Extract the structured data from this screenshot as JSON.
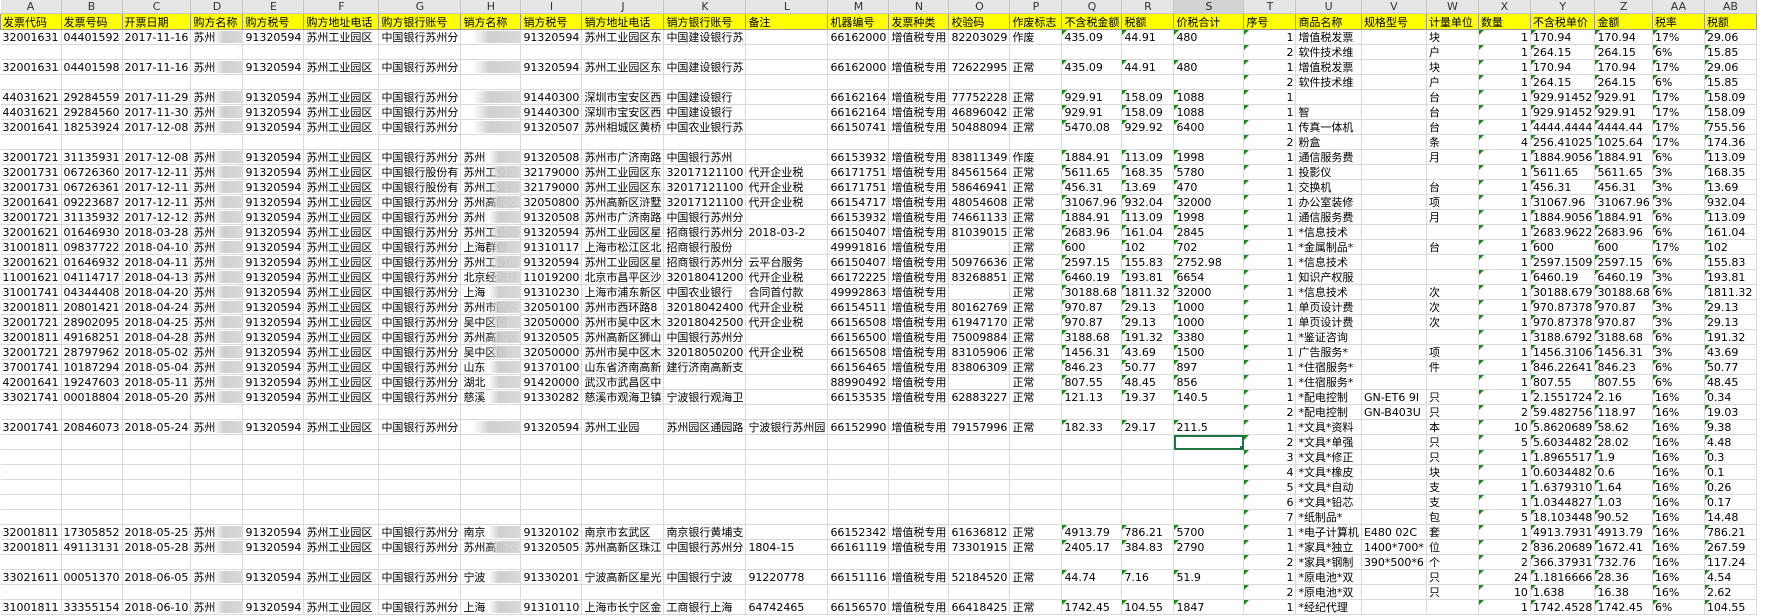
{
  "columns": [
    {
      "letter": "A",
      "header": "发票代码"
    },
    {
      "letter": "B",
      "header": "发票号码"
    },
    {
      "letter": "C",
      "header": "开票日期"
    },
    {
      "letter": "D",
      "header": "购方名称"
    },
    {
      "letter": "E",
      "header": "购方税号"
    },
    {
      "letter": "F",
      "header": "购方地址电话"
    },
    {
      "letter": "G",
      "header": "购方银行账号"
    },
    {
      "letter": "H",
      "header": "销方名称"
    },
    {
      "letter": "I",
      "header": "销方税号"
    },
    {
      "letter": "J",
      "header": "销方地址电话"
    },
    {
      "letter": "K",
      "header": "销方银行账号"
    },
    {
      "letter": "L",
      "header": "备注"
    },
    {
      "letter": "M",
      "header": "机器编号"
    },
    {
      "letter": "N",
      "header": "发票种类"
    },
    {
      "letter": "O",
      "header": "校验码"
    },
    {
      "letter": "P",
      "header": "作废标志"
    },
    {
      "letter": "Q",
      "header": "不含税金额"
    },
    {
      "letter": "R",
      "header": "税额"
    },
    {
      "letter": "S",
      "header": "价税合计"
    },
    {
      "letter": "T",
      "header": "序号"
    },
    {
      "letter": "U",
      "header": "商品名称"
    },
    {
      "letter": "V",
      "header": "规格型号"
    },
    {
      "letter": "W",
      "header": "计量单位"
    },
    {
      "letter": "X",
      "header": "数量"
    },
    {
      "letter": "Y",
      "header": "不含税单价"
    },
    {
      "letter": "Z",
      "header": "金额"
    },
    {
      "letter": "AA",
      "header": "税率"
    },
    {
      "letter": "AB",
      "header": "税额"
    }
  ],
  "selected_column": "S",
  "active_cell": {
    "row": 27,
    "col": "S"
  },
  "rows": [
    [
      "32001631",
      "04401592",
      "2017-11-16",
      "苏州",
      "91320594",
      "苏州工业园区",
      "中国银行苏州分",
      "",
      "91320594",
      "苏州工业园区东",
      "中国建设银行苏",
      "",
      "66162000",
      "增值税专用",
      "82203029",
      "作废",
      "435.09",
      "44.91",
      "480",
      "1",
      "增值税发票",
      "",
      "块",
      "1",
      "170.94",
      "170.94",
      "17%",
      "29.06"
    ],
    [
      "",
      "",
      "",
      "",
      "",
      "",
      "",
      "",
      "",
      "",
      "",
      "",
      "",
      "",
      "",
      "",
      "",
      "",
      "",
      "2",
      "软件技术维",
      "",
      "户",
      "1",
      "264.15",
      "264.15",
      "6%",
      "15.85"
    ],
    [
      "32001631",
      "04401598",
      "2017-11-16",
      "苏州",
      "91320594",
      "苏州工业园区",
      "中国银行苏州分",
      "",
      "91320594",
      "苏州工业园区东",
      "中国建设银行苏",
      "",
      "66162000",
      "增值税专用",
      "72622995",
      "正常",
      "435.09",
      "44.91",
      "480",
      "1",
      "增值税发票",
      "",
      "块",
      "1",
      "170.94",
      "170.94",
      "17%",
      "29.06"
    ],
    [
      "",
      "",
      "",
      "",
      "",
      "",
      "",
      "",
      "",
      "",
      "",
      "",
      "",
      "",
      "",
      "",
      "",
      "",
      "",
      "2",
      "软件技术维",
      "",
      "户",
      "1",
      "264.15",
      "264.15",
      "6%",
      "15.85"
    ],
    [
      "44031621",
      "29284559",
      "2017-11-29",
      "苏州",
      "91320594",
      "苏州工业园区",
      "中国银行苏州分",
      "",
      "91440300",
      "深圳市宝安区西",
      "中国建设银行",
      "",
      "66162164",
      "增值税专用",
      "77752228",
      "正常",
      "929.91",
      "158.09",
      "1088",
      "1",
      "",
      "",
      "台",
      "1",
      "929.91452",
      "929.91",
      "17%",
      "158.09"
    ],
    [
      "44031621",
      "29284560",
      "2017-11-30",
      "苏州",
      "91320594",
      "苏州工业园区",
      "中国银行苏州分",
      "",
      "91440300",
      "深圳市宝安区西",
      "中国建设银行",
      "",
      "66162164",
      "增值税专用",
      "46896042",
      "正常",
      "929.91",
      "158.09",
      "1088",
      "1",
      "智",
      "",
      "台",
      "1",
      "929.91452",
      "929.91",
      "17%",
      "158.09"
    ],
    [
      "32001641",
      "18253924",
      "2017-12-08",
      "苏州",
      "91320594",
      "苏州工业园区",
      "中国银行苏州分",
      "",
      "91320507",
      "苏州相城区黄桥",
      "中国农业银行苏",
      "",
      "66150741",
      "增值税专用",
      "50488094",
      "正常",
      "5470.08",
      "929.92",
      "6400",
      "1",
      "传真一体机",
      "",
      "台",
      "1",
      "4444.4444",
      "4444.44",
      "17%",
      "755.56"
    ],
    [
      "",
      "",
      "",
      "",
      "",
      "",
      "",
      "",
      "",
      "",
      "",
      "",
      "",
      "",
      "",
      "",
      "",
      "",
      "",
      "2",
      "粉盒",
      "",
      "条",
      "4",
      "256.41025",
      "1025.64",
      "17%",
      "174.36"
    ],
    [
      "32001721",
      "31135931",
      "2017-12-08",
      "苏州",
      "91320594",
      "苏州工业园区",
      "中国银行苏州分",
      "苏州",
      "91320508",
      "苏州市广济南路",
      "中国银行苏州",
      "",
      "66153932",
      "增值税专用",
      "83811349",
      "作废",
      "1884.91",
      "113.09",
      "1998",
      "1",
      "通信服务费",
      "",
      "月",
      "1",
      "1884.9056",
      "1884.91",
      "6%",
      "113.09"
    ],
    [
      "32001731",
      "06726360",
      "2017-12-11",
      "苏州",
      "91320594",
      "苏州工业园区",
      "中国银行股份有",
      "苏州工业园",
      "32179000",
      "苏州工业园区东",
      "32017121100",
      "代开企业税",
      "66171751",
      "增值税专用",
      "84561564",
      "正常",
      "5611.65",
      "168.35",
      "5780",
      "1",
      "投影仪",
      "",
      "",
      "1",
      "5611.65",
      "5611.65",
      "3%",
      "168.35"
    ],
    [
      "32001731",
      "06726361",
      "2017-12-11",
      "苏州",
      "91320594",
      "苏州工业园区",
      "中国银行股份有",
      "苏州工业园",
      "32179000",
      "苏州工业园区东",
      "32017121100",
      "代开企业税",
      "66171751",
      "增值税专用",
      "58646941",
      "正常",
      "456.31",
      "13.69",
      "470",
      "1",
      "交换机",
      "",
      "台",
      "1",
      "456.31",
      "456.31",
      "3%",
      "13.69"
    ],
    [
      "32001641",
      "09223687",
      "2017-12-11",
      "苏州",
      "91320594",
      "苏州工业园区",
      "中国银行苏州分",
      "苏州高新区",
      "32050800",
      "苏州高新区浒墅",
      "32017121100",
      "代开企业税",
      "66154717",
      "增值税专用",
      "48054608",
      "正常",
      "31067.96",
      "932.04",
      "32000",
      "1",
      "办公室装修",
      "",
      "项",
      "1",
      "31067.96",
      "31067.96",
      "3%",
      "932.04"
    ],
    [
      "32001721",
      "31135932",
      "2017-12-12",
      "苏州",
      "91320594",
      "苏州工业园区",
      "中国银行苏州分",
      "苏州",
      "91320508",
      "苏州市广济南路",
      "中国银行苏州分",
      "",
      "66153932",
      "增值税专用",
      "74661133",
      "正常",
      "1884.91",
      "113.09",
      "1998",
      "1",
      "通信服务费",
      "",
      "月",
      "1",
      "1884.9056",
      "1884.91",
      "6%",
      "113.09"
    ],
    [
      "32001621",
      "01646930",
      "2018-03-28",
      "苏州",
      "91320594",
      "苏州工业园区",
      "中国银行苏州分",
      "苏州工业园",
      "91320594",
      "苏州工业园区星",
      "招商银行苏州分",
      "2018-03-2",
      "66150407",
      "增值税专用",
      "81039015",
      "正常",
      "2683.96",
      "161.04",
      "2845",
      "1",
      "*信息技术",
      "",
      "",
      "1",
      "2683.9622",
      "2683.96",
      "6%",
      "161.04"
    ],
    [
      "31001811",
      "09837722",
      "2018-04-10",
      "苏州",
      "91320594",
      "苏州工业园区",
      "中国银行苏州分",
      "上海群傲",
      "91310117",
      "上海市松江区北",
      "招商银行股份",
      "",
      "49991816",
      "增值税专用",
      "",
      "正常",
      "600",
      "102",
      "702",
      "1",
      "*金属制品*",
      "",
      "台",
      "1",
      "600",
      "600",
      "17%",
      "102"
    ],
    [
      "32001621",
      "01646932",
      "2018-04-11",
      "苏州",
      "91320594",
      "苏州工业园区",
      "中国银行苏州分",
      "苏州工业园",
      "91320594",
      "苏州工业园区星",
      "招商银行苏州分",
      "云平台服务",
      "66150407",
      "增值税专用",
      "50976636",
      "正常",
      "2597.15",
      "155.83",
      "2752.98",
      "1",
      "*信息技术",
      "",
      "",
      "1",
      "2597.1509",
      "2597.15",
      "6%",
      "155.83"
    ],
    [
      "11001621",
      "04114717",
      "2018-04-13",
      "苏州",
      "91320594",
      "苏州工业园区",
      "中国银行苏州分",
      "北京经济技",
      "11019200",
      "北京市昌平区沙",
      "32018041200",
      "代开企业税",
      "66172225",
      "增值税专用",
      "83268851",
      "正常",
      "6460.19",
      "193.81",
      "6654",
      "1",
      "知识产权服",
      "",
      "",
      "1",
      "6460.19",
      "6460.19",
      "3%",
      "193.81"
    ],
    [
      "31001741",
      "04344408",
      "2018-04-20",
      "苏州",
      "91320594",
      "苏州工业园区",
      "中国银行苏州分",
      "上海",
      "91310230",
      "上海市浦东新区",
      "中国农业银行",
      "合同首付款",
      "49992863",
      "增值税专用",
      "",
      "正常",
      "30188.68",
      "1811.32",
      "32000",
      "1",
      "*信息技术",
      "",
      "次",
      "1",
      "30188.679",
      "30188.68",
      "6%",
      "1811.32"
    ],
    [
      "32001811",
      "20801421",
      "2018-04-24",
      "苏州",
      "91320594",
      "苏州工业园区",
      "中国银行苏州分",
      "苏州市园区",
      "32050100",
      "苏州市西环路8",
      "32018042400",
      "代开企业税",
      "66154511",
      "增值税专用",
      "80162769",
      "正常",
      "970.87",
      "29.13",
      "1000",
      "1",
      "单页设计费",
      "",
      "次",
      "1",
      "970.87378",
      "970.87",
      "3%",
      "29.13"
    ],
    [
      "32001721",
      "28902095",
      "2018-04-25",
      "苏州",
      "91320594",
      "苏州工业园区",
      "中国银行苏州分",
      "吴中区国",
      "32050000",
      "苏州市吴中区木",
      "32018042500",
      "代开企业税",
      "66156508",
      "增值税专用",
      "61947170",
      "正常",
      "970.87",
      "29.13",
      "1000",
      "1",
      "单页设计费",
      "",
      "次",
      "1",
      "970.87378",
      "970.87",
      "3%",
      "29.13"
    ],
    [
      "32001811",
      "49168251",
      "2018-04-28",
      "苏州",
      "91320594",
      "苏州工业园区",
      "中国银行苏州分",
      "苏州高新区",
      "91320505",
      "苏州高新区狮山",
      "中国银行苏州分",
      "",
      "66156500",
      "增值税专用",
      "75009884",
      "正常",
      "3188.68",
      "191.32",
      "3380",
      "1",
      "*鉴证咨询",
      "",
      "",
      "1",
      "3188.6792",
      "3188.68",
      "6%",
      "191.32"
    ],
    [
      "32001721",
      "28797962",
      "2018-05-02",
      "苏州",
      "91320594",
      "苏州工业园区",
      "中国银行苏州分",
      "吴中区国",
      "32050000",
      "苏州市吴中区木",
      "32018050200",
      "代开企业税",
      "66156508",
      "增值税专用",
      "83105906",
      "正常",
      "1456.31",
      "43.69",
      "1500",
      "1",
      "广告服务*",
      "",
      "项",
      "1",
      "1456.3106",
      "1456.31",
      "3%",
      "43.69"
    ],
    [
      "37001741",
      "10187294",
      "2018-05-04",
      "苏州",
      "91320594",
      "苏州工业园区",
      "中国银行苏州分",
      "山东",
      "91370100",
      "山东省济南高新",
      "建行济南高新支",
      "",
      "66156465",
      "增值税专用",
      "83806309",
      "正常",
      "846.23",
      "50.77",
      "897",
      "1",
      "*住宿服务*",
      "",
      "件",
      "1",
      "846.22641",
      "846.23",
      "6%",
      "50.77"
    ],
    [
      "42001641",
      "19247603",
      "2018-05-11",
      "苏州",
      "91320594",
      "苏州工业园区",
      "中国银行苏州分",
      "湖北",
      "91420000",
      "武汉市武昌区中",
      "",
      "",
      "88990492",
      "增值税专用",
      "",
      "正常",
      "807.55",
      "48.45",
      "856",
      "1",
      "*住宿服务*",
      "",
      "",
      "1",
      "807.55",
      "807.55",
      "6%",
      "48.45"
    ],
    [
      "33021741",
      "00018804",
      "2018-05-20",
      "苏州",
      "91320594",
      "苏州工业园区",
      "中国银行苏州分",
      "慈溪",
      "91330282",
      "慈溪市观海卫镇",
      "宁波银行观海卫",
      "",
      "66153535",
      "增值税专用",
      "62883227",
      "正常",
      "121.13",
      "19.37",
      "140.5",
      "1",
      "*配电控制",
      "GN-ET6 9I",
      "只",
      "1",
      "2.1551724",
      "2.16",
      "16%",
      "0.34"
    ],
    [
      "",
      "",
      "",
      "",
      "",
      "",
      "",
      "",
      "",
      "",
      "",
      "",
      "",
      "",
      "",
      "",
      "",
      "",
      "",
      "2",
      "*配电控制",
      "GN-B403U",
      "只",
      "2",
      "59.482756",
      "118.97",
      "16%",
      "19.03"
    ],
    [
      "32001741",
      "20846073",
      "2018-05-24",
      "苏州",
      "91320594",
      "苏州工业园区",
      "中国银行苏州分",
      "",
      "91320594",
      "苏州工业园",
      "苏州园区通园路",
      "宁波银行苏州园",
      "66152990",
      "增值税专用",
      "79157996",
      "正常",
      "182.33",
      "29.17",
      "211.5",
      "1",
      "*文具*资料",
      "",
      "本",
      "10",
      "5.8620689",
      "58.62",
      "16%",
      "9.38"
    ],
    [
      "",
      "",
      "",
      "",
      "",
      "",
      "",
      "",
      "",
      "",
      "",
      "",
      "",
      "",
      "",
      "",
      "",
      "",
      "",
      "2",
      "*文具*单强",
      "",
      "只",
      "5",
      "5.6034482",
      "28.02",
      "16%",
      "4.48"
    ],
    [
      "",
      "",
      "",
      "",
      "",
      "",
      "",
      "",
      "",
      "",
      "",
      "",
      "",
      "",
      "",
      "",
      "",
      "",
      "",
      "3",
      "*文具*修正",
      "",
      "只",
      "1",
      "1.8965517",
      "1.9",
      "16%",
      "0.3"
    ],
    [
      "",
      "",
      "",
      "",
      "",
      "",
      "",
      "",
      "",
      "",
      "",
      "",
      "",
      "",
      "",
      "",
      "",
      "",
      "",
      "4",
      "*文具*橡皮",
      "",
      "块",
      "1",
      "0.6034482",
      "0.6",
      "16%",
      "0.1"
    ],
    [
      "",
      "",
      "",
      "",
      "",
      "",
      "",
      "",
      "",
      "",
      "",
      "",
      "",
      "",
      "",
      "",
      "",
      "",
      "",
      "5",
      "*文具*自动",
      "",
      "支",
      "1",
      "1.6379310",
      "1.64",
      "16%",
      "0.26"
    ],
    [
      "",
      "",
      "",
      "",
      "",
      "",
      "",
      "",
      "",
      "",
      "",
      "",
      "",
      "",
      "",
      "",
      "",
      "",
      "",
      "6",
      "*文具*铅芯",
      "",
      "支",
      "1",
      "1.0344827",
      "1.03",
      "16%",
      "0.17"
    ],
    [
      "",
      "",
      "",
      "",
      "",
      "",
      "",
      "",
      "",
      "",
      "",
      "",
      "",
      "",
      "",
      "",
      "",
      "",
      "",
      "7",
      "*纸制品*",
      "",
      "包",
      "5",
      "18.103448",
      "90.52",
      "16%",
      "14.48"
    ],
    [
      "32001811",
      "17305852",
      "2018-05-25",
      "苏州",
      "91320594",
      "苏州工业园区",
      "中国银行苏州分",
      "南京",
      "91320102",
      "南京市玄武区",
      "南京银行黄埔支",
      "",
      "66152342",
      "增值税专用",
      "61636812",
      "正常",
      "4913.79",
      "786.21",
      "5700",
      "1",
      "*电子计算机",
      "E480 02C",
      "套",
      "1",
      "4913.7931",
      "4913.79",
      "16%",
      "786.21"
    ],
    [
      "32001811",
      "49113131",
      "2018-05-28",
      "苏州",
      "91320594",
      "苏州工业园区",
      "中国银行苏州分",
      "苏州高新区",
      "91320505",
      "苏州高新区珠江",
      "中国银行苏州分",
      "1804-15",
      "66161119",
      "增值税专用",
      "73301915",
      "正常",
      "2405.17",
      "384.83",
      "2790",
      "1",
      "*家具*独立",
      "1400*700*",
      "位",
      "2",
      "836.20689",
      "1672.41",
      "16%",
      "267.59"
    ],
    [
      "",
      "",
      "",
      "",
      "",
      "",
      "",
      "",
      "",
      "",
      "",
      "",
      "",
      "",
      "",
      "",
      "",
      "",
      "",
      "2",
      "*家具*钢制",
      "390*500*6",
      "个",
      "2",
      "366.37931",
      "732.76",
      "16%",
      "117.24"
    ],
    [
      "33021611",
      "00051370",
      "2018-06-05",
      "苏州",
      "91320594",
      "苏州工业园区",
      "中国银行苏州分",
      "宁波",
      "91330201",
      "宁波高新区星光",
      "中国银行宁波",
      "91220778",
      "66151116",
      "增值税专用",
      "52184520",
      "正常",
      "44.74",
      "7.16",
      "51.9",
      "1",
      "*原电池*双",
      "",
      "只",
      "24",
      "1.1816666",
      "28.36",
      "16%",
      "4.54"
    ],
    [
      "",
      "",
      "",
      "",
      "",
      "",
      "",
      "",
      "",
      "",
      "",
      "",
      "",
      "",
      "",
      "",
      "",
      "",
      "",
      "2",
      "*原电池*双",
      "",
      "只",
      "10",
      "1.638",
      "16.38",
      "16%",
      "2.62"
    ],
    [
      "31001811",
      "33355154",
      "2018-06-10",
      "苏州",
      "91320594",
      "苏州工业园区",
      "中国银行苏州分",
      "上海",
      "91310110",
      "上海市长宁区金",
      "工商银行上海",
      "64742465",
      "66156570",
      "增值税专用",
      "66418425",
      "正常",
      "1742.45",
      "104.55",
      "1847",
      "1",
      "*经纪代理",
      "",
      "",
      "1",
      "1742.4528",
      "1742.45",
      "6%",
      "104.55"
    ]
  ]
}
